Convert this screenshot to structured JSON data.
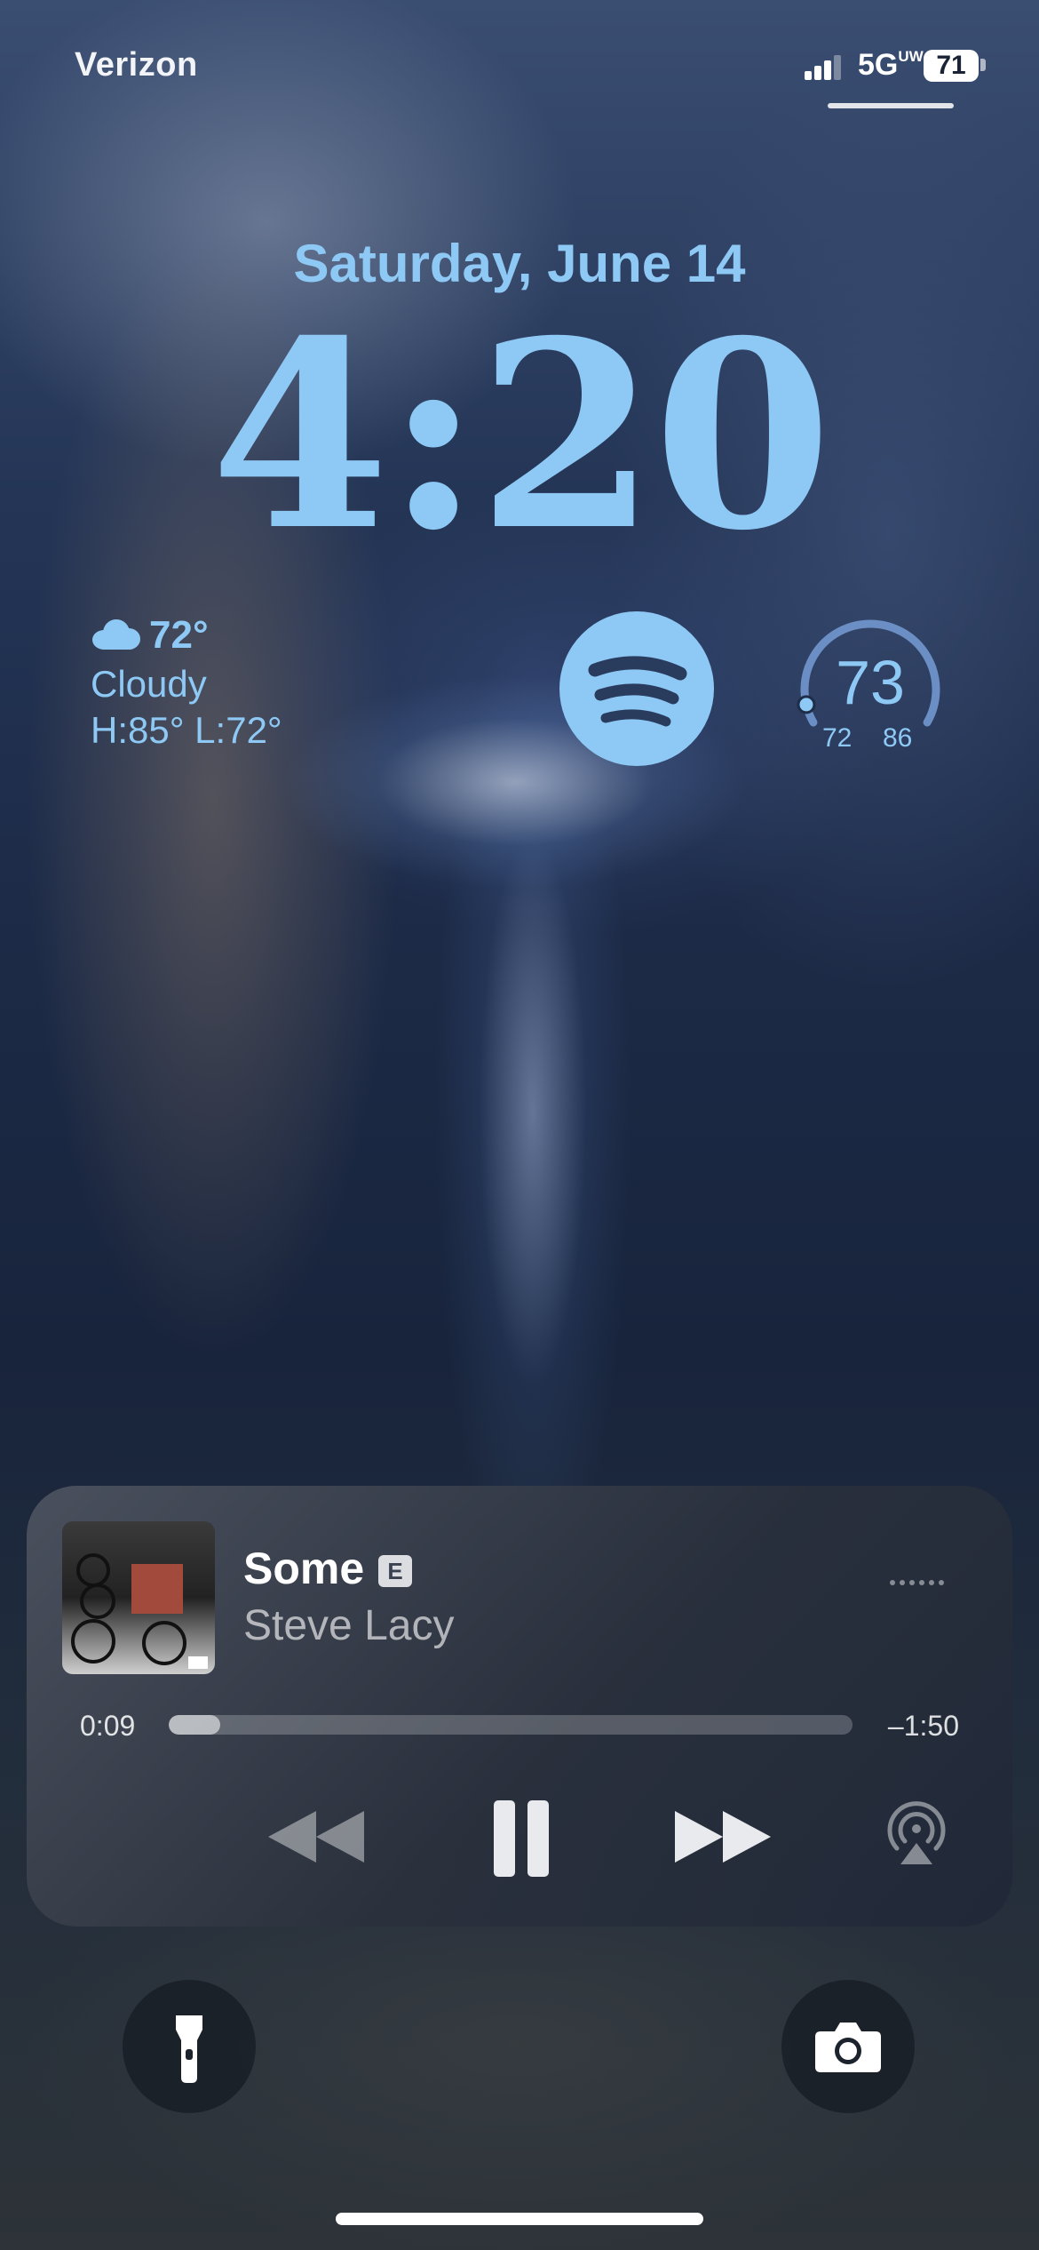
{
  "status_bar": {
    "carrier": "Verizon",
    "network": "5G",
    "network_suffix": "UW",
    "battery": "71"
  },
  "lock_screen": {
    "date": "Saturday, June 14",
    "time": "4:20"
  },
  "weather_widget": {
    "temperature": "72°",
    "condition": "Cloudy",
    "high_low": "H:85° L:72°",
    "icon": "cloud-icon"
  },
  "spotify_widget": {
    "icon": "spotify-icon"
  },
  "gauge_widget": {
    "value": "73",
    "min": "72",
    "max": "86",
    "level": 0.07
  },
  "now_playing": {
    "title": "Some",
    "explicit": "E",
    "artist": "Steve Lacy",
    "elapsed": "0:09",
    "remaining": "–1:50",
    "progress": 0.075
  },
  "colors": {
    "accent": "#8ec9f5",
    "player_bg": "#3a404c",
    "text_primary": "#ffffff"
  },
  "icons": {
    "rewind": "rewind-icon",
    "pause": "pause-icon",
    "forward": "fast-forward-icon",
    "airplay": "airplay-icon",
    "flashlight": "flashlight-icon",
    "camera": "camera-icon",
    "more": "more-icon"
  }
}
